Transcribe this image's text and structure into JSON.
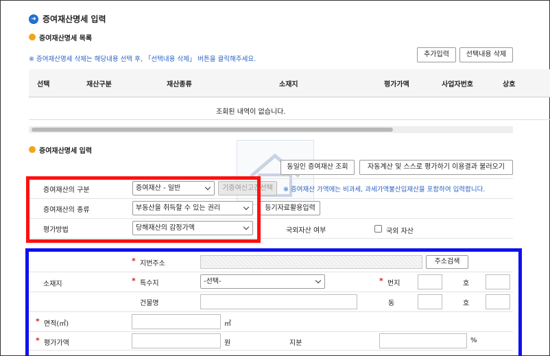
{
  "page": {
    "title": "증여재산명세 입력"
  },
  "list_section": {
    "title": "증여재산명세 목록",
    "notice": "※ 증여재산명세 삭제는 해당내용 선택 후, 「선택내용 삭제」 버튼을 클릭해주세요.",
    "add_button": "추가입력",
    "delete_button": "선택내용 삭제",
    "columns": [
      "선택",
      "재산구분",
      "재산종류",
      "소재지",
      "평가가액",
      "사업자번호",
      "상호"
    ],
    "empty_message": "조회된 내역이 없습니다."
  },
  "input_section": {
    "title": "증여재산명세 입력",
    "same_person_button": "동일인 증여재산 조회",
    "auto_calc_button": "자동계산 및 스스로 평가하기 이용결과 불러오기",
    "fields": {
      "category_label": "증여재산의 구분",
      "category_value": "증여재산 - 일반",
      "prev_report_button": "기증여신고건선택",
      "category_notice_prefix": "※ 증여재산 가액에는 ",
      "category_notice_rest": "비과세, 과세가액불산입재산을 포함하여 입력합니다.",
      "type_label": "증여재산의 종류",
      "type_value": "부동산을 취득할 수 있는 권리",
      "registry_button": "등기자료활용입력",
      "method_label": "평가방법",
      "method_value": "당해재산의 감정가액",
      "foreign_label": "국외자산 여부",
      "foreign_checkbox_label": "국외 자산",
      "foreign_checked": false
    },
    "address": {
      "group_label": "소재지",
      "lot_label": "지번주소",
      "search_button": "주소검색",
      "special_label": "특수지",
      "special_value": "-선택-",
      "bunji_label": "번지",
      "ho_label": "호",
      "building_label": "건물명",
      "dong_label": "동"
    },
    "area_label": "면적(㎡)",
    "area_unit": "㎡",
    "value_label": "평가가액",
    "value_unit": "원",
    "share_label": "지분",
    "share_unit": "%"
  },
  "colors": {
    "red_highlight": "#ff1010",
    "blue_highlight": "#1010ee",
    "accent": "#1f6fd1"
  }
}
